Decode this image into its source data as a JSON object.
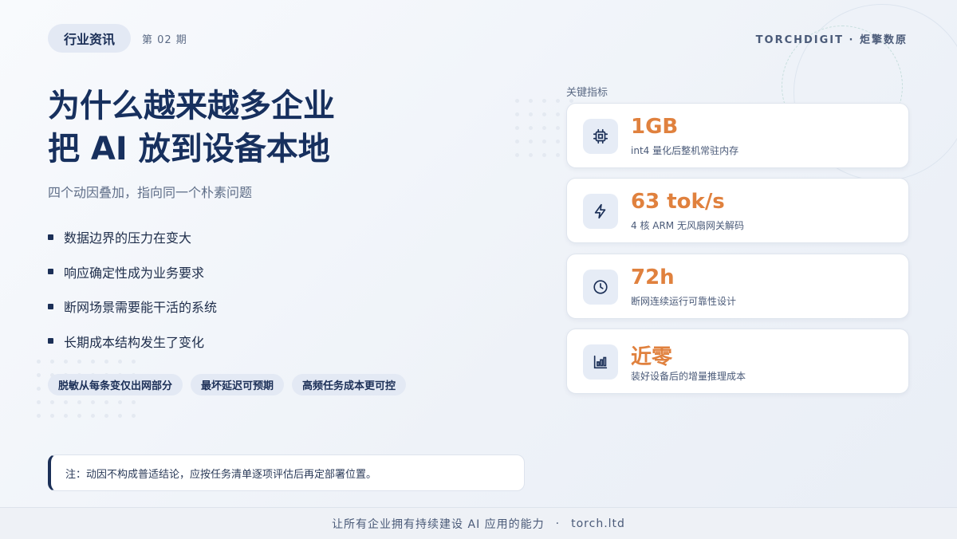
{
  "header": {
    "tag": "行业资讯",
    "issue": "第 02 期",
    "brand": "TORCHDIGIT · 炬擎数原"
  },
  "hero": {
    "title_line1": "为什么越来越多企业",
    "title_line2": "把 AI 放到设备本地",
    "subtitle": "四个动因叠加，指向同一个朴素问题"
  },
  "reasons": [
    "数据边界的压力在变大",
    "响应确定性成为业务要求",
    "断网场景需要能干活的系统",
    "长期成本结构发生了变化"
  ],
  "chips": [
    "脱敏从每条变仅出网部分",
    "最坏延迟可预期",
    "高频任务成本更可控"
  ],
  "note": "注：动因不构成普适结论，应按任务清单逐项评估后再定部署位置。",
  "metrics": {
    "label": "关键指标",
    "accent_color": "#e0813e",
    "items": [
      {
        "icon": "chip-icon",
        "value": "1GB",
        "desc": "int4 量化后整机常驻内存"
      },
      {
        "icon": "lightning-icon",
        "value": "63 tok/s",
        "desc": "4 核 ARM 无风扇网关解码"
      },
      {
        "icon": "clock-icon",
        "value": "72h",
        "desc": "断网连续运行可靠性设计"
      },
      {
        "icon": "bar-chart-icon",
        "value": "近零",
        "desc": "装好设备后的增量推理成本"
      }
    ]
  },
  "footer": {
    "slogan": "让所有企业拥有持续建设 AI 应用的能力",
    "separator": "·",
    "site": "torch.ltd"
  }
}
